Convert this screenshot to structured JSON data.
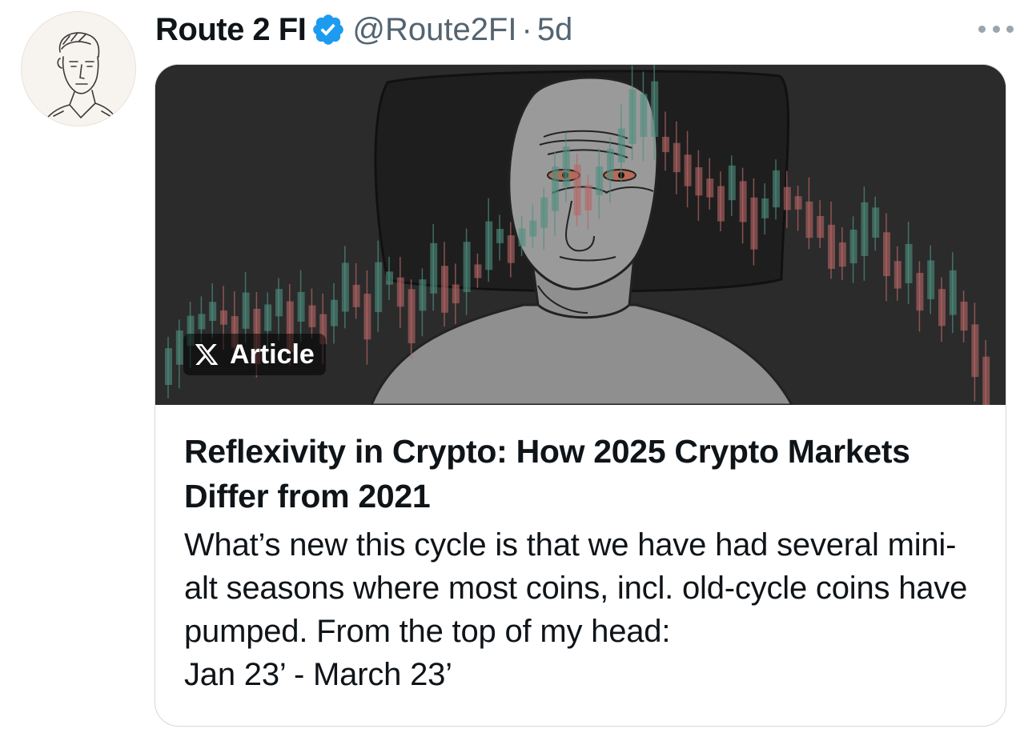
{
  "tweet": {
    "author": {
      "display_name": "Route 2 FI",
      "handle": "@Route2FI",
      "verified": true,
      "avatar_icon": "sketch-portrait-avatar"
    },
    "separator": "·",
    "timestamp": "5d",
    "more_icon": "more-horizontal-icon"
  },
  "article_card": {
    "badge_icon": "x-logo-icon",
    "badge_label": "Article",
    "cover_image": "wojak-candlestick-chart-cover",
    "title": "Reflexivity in Crypto: How 2025 Crypto Markets Differ from 2021",
    "excerpt": "What’s new this cycle is that we have had several mini-alt seasons where most coins, incl. old-cycle coins have pumped. From the top of my head:\nJan 23’ - March 23’"
  },
  "colors": {
    "verified_blue": "#1d9bf0",
    "text_primary": "#0f1419",
    "text_secondary": "#536471",
    "card_border": "#cfd9de",
    "candle_green": "#4f8f7f",
    "candle_red": "#b86666"
  }
}
